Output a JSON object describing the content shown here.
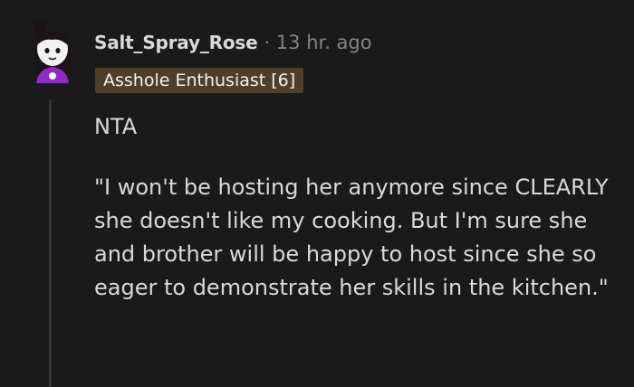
{
  "comment": {
    "author": "Salt_Spray_Rose",
    "separator": "·",
    "time": "13 hr. ago",
    "flair": "Asshole Enthusiast [6]",
    "paragraphs": [
      "NTA",
      "\"I won't be hosting her anymore since CLEARLY she doesn't like my cooking. But I'm sure she and brother will be happy to host since she so eager to demonstrate her skills in the kitchen.\""
    ]
  },
  "colors": {
    "background": "#1a1a1b",
    "text": "#d7dadc",
    "meta": "#818384",
    "flair_bg": "#4f3f2a",
    "avatar_shirt": "#8e2bc4"
  },
  "icons": {
    "avatar": "snoo-avatar-icon"
  }
}
